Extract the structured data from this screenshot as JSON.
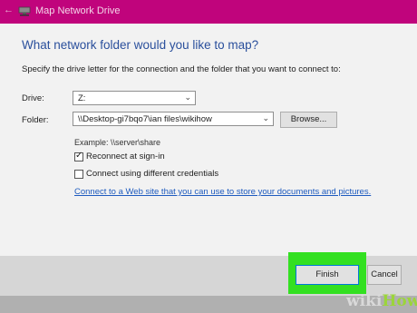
{
  "window": {
    "title": "Map Network Drive",
    "back_glyph": "←"
  },
  "dialog": {
    "heading": "What network folder would you like to map?",
    "instruction": "Specify the drive letter for the connection and the folder that you want to connect to:",
    "drive_label": "Drive:",
    "drive_value": "Z:",
    "folder_label": "Folder:",
    "folder_value": "\\\\Desktop-gi7bqo7\\ian files\\wikihow",
    "browse_label": "Browse...",
    "example": "Example: \\\\server\\share",
    "reconnect_label": "Reconnect at sign-in",
    "reconnect_checked": true,
    "credentials_label": "Connect using different credentials",
    "credentials_checked": false,
    "link_text": "Connect to a Web site that you can use to store your documents and pictures."
  },
  "footer": {
    "finish_label": "Finish",
    "cancel_label": "Cancel"
  },
  "watermark": {
    "part1": "wiki",
    "part2": "How"
  },
  "colors": {
    "titlebar": "#c0047c",
    "heading": "#2a4f9c",
    "link": "#1e5bbf",
    "highlight": "#33e021"
  }
}
